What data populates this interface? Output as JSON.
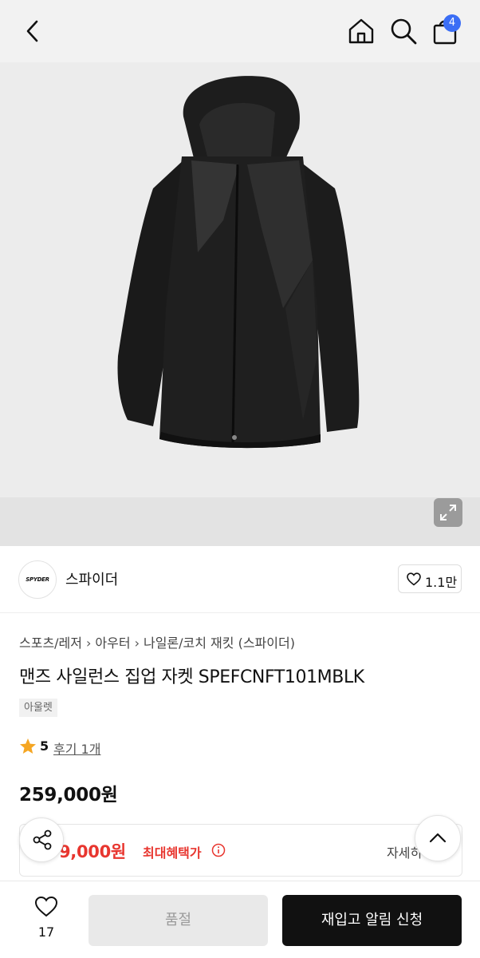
{
  "header": {
    "cart_count": "4"
  },
  "brand": {
    "logo_text": "SPYDER",
    "name": "스파이더",
    "like_count": "1.1만"
  },
  "product": {
    "breadcrumb": [
      "스포츠/레저",
      "아우터",
      "나일론/코치 재킷 (스파이더)"
    ],
    "title": "맨즈 사일런스 집업 자켓 SPEFCNFT101MBLK",
    "tag": "아울렛",
    "rating": "5",
    "review_link": "후기 1개",
    "price": "259,000원"
  },
  "benefit": {
    "price": "9,000원",
    "label": "최대혜택가",
    "detail_link": "자세히"
  },
  "bottom_bar": {
    "wish_count": "17",
    "soldout_label": "품절",
    "restock_label": "재입고 알림 신청"
  }
}
